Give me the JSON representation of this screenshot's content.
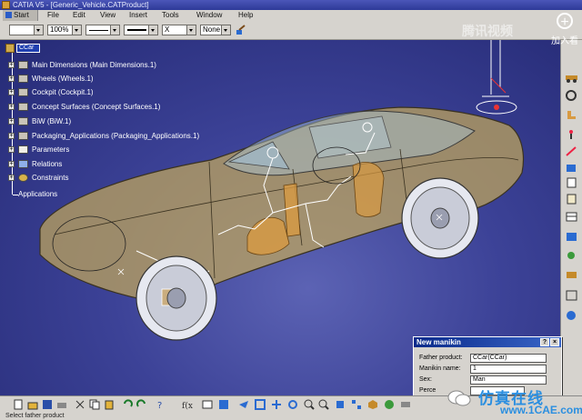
{
  "window": {
    "title": "CATIA V5 - [Generic_Vehicle.CATProduct]"
  },
  "menu": {
    "items": [
      "Start",
      "File",
      "Edit",
      "View",
      "Insert",
      "Tools",
      "Window",
      "Help"
    ]
  },
  "toolbar": {
    "color_value": "",
    "transparency_value": "100%",
    "linetype_value": "",
    "thickness_value": "",
    "point_value": "X",
    "layer_value": "None"
  },
  "tree": {
    "root": "CCar",
    "items": [
      "Main Dimensions (Main Dimensions.1)",
      "Wheels (Wheels.1)",
      "Cockpit (Cockpit.1)",
      "Concept Surfaces (Concept Surfaces.1)",
      "BiW (BiW.1)",
      "Packaging_Applications (Packaging_Applications.1)",
      "Parameters",
      "Relations",
      "Constraints"
    ],
    "applications": "Applications"
  },
  "dialog": {
    "title": "New manikin",
    "father_label": "Father product:",
    "father_value": "CCar(CCar)",
    "name_label": "Manikin name:",
    "name_value": "1",
    "sex_label": "Sex:",
    "sex_value": "Man",
    "percentile_label": "Perce"
  },
  "status": {
    "text": "Select father product"
  },
  "watermarks": {
    "video": "腾讯视频",
    "add_caption": "加入看",
    "cn_brand": "仿真在线",
    "site": "www.1CAE.com"
  },
  "colors": {
    "viewport_bg": "#3c4297",
    "car_body": "#c2a85a",
    "dialog_title": "#0a2a8a",
    "watermark_blue": "#2b8fe0"
  }
}
